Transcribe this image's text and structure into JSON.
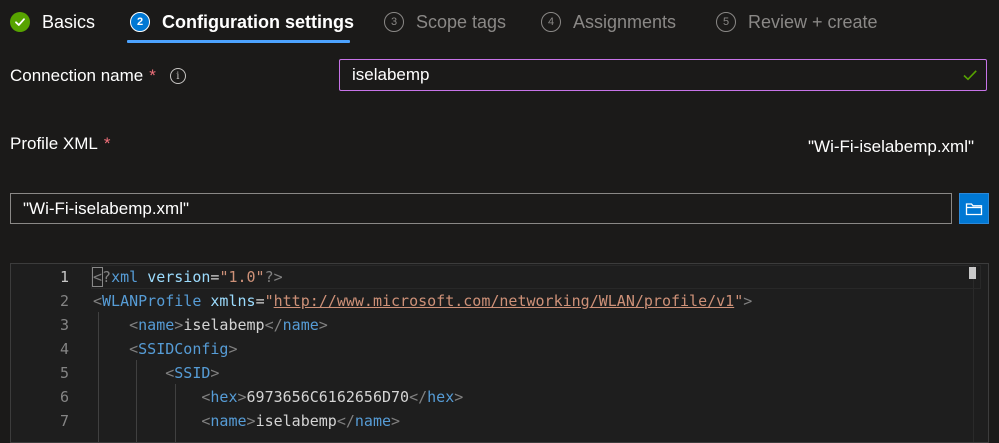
{
  "steps": [
    {
      "number": "",
      "label": "Basics",
      "state": "done"
    },
    {
      "number": "2",
      "label": "Configuration settings",
      "state": "active"
    },
    {
      "number": "3",
      "label": "Scope tags",
      "state": "pending"
    },
    {
      "number": "4",
      "label": "Assignments",
      "state": "pending"
    },
    {
      "number": "5",
      "label": "Review + create",
      "state": "pending"
    }
  ],
  "form": {
    "connection_name_label": "Connection name",
    "required_mark": "*",
    "connection_name_value": "iselabemp",
    "profile_xml_label": "Profile XML",
    "profile_xml_file": "\"Wi-Fi-iselabemp.xml\"",
    "file_input_value": "\"Wi-Fi-iselabemp.xml\""
  },
  "editor": {
    "line_numbers": [
      "1",
      "2",
      "3",
      "4",
      "5",
      "6",
      "7"
    ],
    "xml_decl": {
      "open": "<",
      "q": "?",
      "name": "xml",
      "attr": "version",
      "eq": "=",
      "val": "\"1.0\"",
      "close": "?>"
    },
    "wlan_open": {
      "lt": "<",
      "name": "WLANProfile",
      "attr": "xmlns",
      "eq": "=",
      "q1": "\"",
      "url": "http://www.microsoft.com/networking/WLAN/profile/v1",
      "q2": "\"",
      "gt": ">"
    },
    "name_line": {
      "lt": "<",
      "open": "name",
      "gt": ">",
      "text": "iselabemp",
      "lt2": "</",
      "close": "name",
      "gt2": ">"
    },
    "ssidconfig_line": {
      "lt": "<",
      "name": "SSIDConfig",
      "gt": ">"
    },
    "ssid_line": {
      "lt": "<",
      "name": "SSID",
      "gt": ">"
    },
    "hex_line": {
      "lt": "<",
      "open": "hex",
      "gt": ">",
      "text": "6973656C6162656D70",
      "lt2": "</",
      "close": "hex",
      "gt2": ">"
    },
    "name2_line": {
      "lt": "<",
      "open": "name",
      "gt": ">",
      "text": "iselabemp",
      "lt2": "</",
      "close": "name",
      "gt2": ">"
    }
  },
  "colors": {
    "accent": "#0078d4",
    "done": "#57a300",
    "focus_border": "#c774e8",
    "required": "#f1707b"
  }
}
